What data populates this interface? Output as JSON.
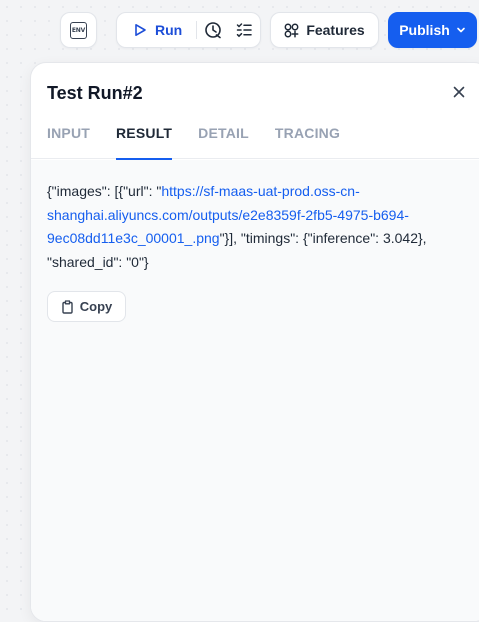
{
  "toolbar": {
    "env_label": "ENV",
    "run_label": "Run",
    "features_label": "Features",
    "publish_label": "Publish"
  },
  "panel": {
    "title": "Test Run#2",
    "tabs": [
      {
        "label": "INPUT",
        "active": false
      },
      {
        "label": "RESULT",
        "active": true
      },
      {
        "label": "DETAIL",
        "active": false
      },
      {
        "label": "TRACING",
        "active": false
      }
    ],
    "result": {
      "prefix": "{\"images\": [{\"url\": \"",
      "url": "https://sf-maas-uat-prod.oss-cn-shanghai.aliyuncs.com/outputs/e2e8359f-2fb5-4975-b694-9ec08dd11e3c_00001_.png",
      "suffix": "\"}], \"timings\": {\"inference\": 3.042}, \"shared_id\": \"0\"}"
    },
    "copy_label": "Copy"
  },
  "colors": {
    "accent": "#155eef",
    "run_text": "#1d4ed8",
    "tab_inactive": "#98a2b3"
  },
  "icons": [
    "env-icon",
    "play-icon",
    "history-icon",
    "checklist-icon",
    "features-icon",
    "chevron-down-icon",
    "close-icon",
    "copy-icon"
  ]
}
